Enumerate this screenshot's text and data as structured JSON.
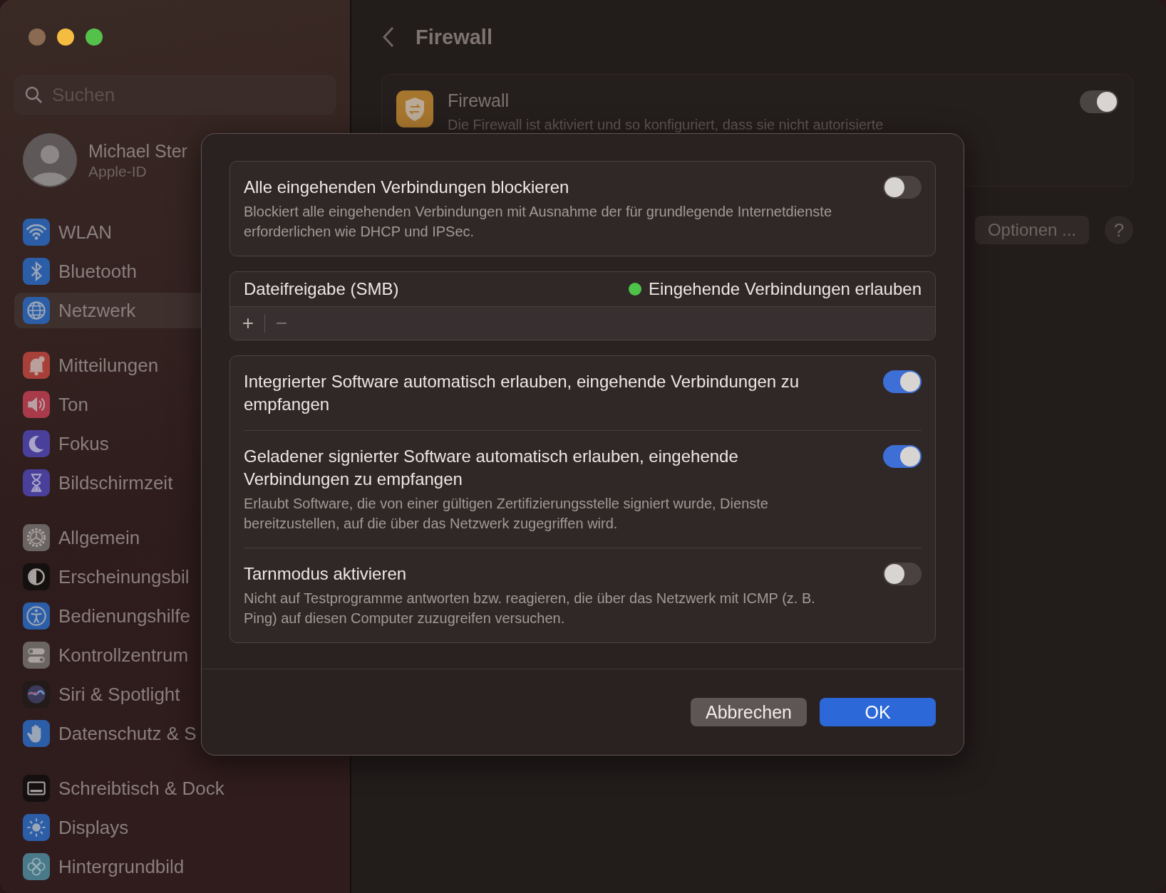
{
  "sidebar": {
    "search": {
      "placeholder": "Suchen"
    },
    "profile": {
      "name": "Michael Ster",
      "subtitle": "Apple-ID"
    },
    "groups": [
      [
        {
          "label": "WLAN",
          "kind": "wifi",
          "selected": false
        },
        {
          "label": "Bluetooth",
          "kind": "bluetooth",
          "selected": false
        },
        {
          "label": "Netzwerk",
          "kind": "globe",
          "selected": true
        }
      ],
      [
        {
          "label": "Mitteilungen",
          "kind": "bell",
          "selected": false
        },
        {
          "label": "Ton",
          "kind": "speaker",
          "selected": false
        },
        {
          "label": "Fokus",
          "kind": "moon",
          "selected": false
        },
        {
          "label": "Bildschirmzeit",
          "kind": "hourglass",
          "selected": false
        }
      ],
      [
        {
          "label": "Allgemein",
          "kind": "gear",
          "selected": false
        },
        {
          "label": "Erscheinungsbil",
          "kind": "appearance",
          "selected": false
        },
        {
          "label": "Bedienungshilfe",
          "kind": "accessibility",
          "selected": false
        },
        {
          "label": "Kontrollzentrum",
          "kind": "switches",
          "selected": false
        },
        {
          "label": "Siri & Spotlight",
          "kind": "orb",
          "selected": false
        },
        {
          "label": "Datenschutz & S",
          "kind": "hand",
          "selected": false
        }
      ],
      [
        {
          "label": "Schreibtisch & Dock",
          "kind": "dock",
          "selected": false
        },
        {
          "label": "Displays",
          "kind": "sun",
          "selected": false
        },
        {
          "label": "Hintergrundbild",
          "kind": "flower",
          "selected": false
        }
      ]
    ]
  },
  "main": {
    "title": "Firewall",
    "card": {
      "title": "Firewall",
      "description": "Die Firewall ist aktiviert und so konfiguriert, dass sie nicht autorisierte",
      "on": true
    },
    "options_button": "Optionen ...",
    "help_button": "?"
  },
  "dialog": {
    "block_all": {
      "title": "Alle eingehenden Verbindungen blockieren",
      "description": "Blockiert alle eingehenden Verbindungen mit Ausnahme der für grundlegende Internetdienste erforderlichen wie DHCP und IPSec.",
      "on": false
    },
    "services": {
      "rows": [
        {
          "name": "Dateifreigabe (SMB)",
          "status": "Eingehende Verbindungen erlauben",
          "color": "#4fc24a"
        }
      ],
      "add": "+",
      "remove": "−"
    },
    "settings": [
      {
        "title": "Integrierter Software automatisch erlauben, eingehende Verbindungen zu empfangen",
        "on": true
      },
      {
        "title": "Geladener signierter Software automatisch erlauben, eingehende Verbindungen zu empfangen",
        "description": "Erlaubt Software, die von einer gültigen Zertifizierungsstelle signiert wurde, Dienste bereitzustellen, auf die über das Netzwerk zugegriffen wird.",
        "on": true
      },
      {
        "title": "Tarnmodus aktivieren",
        "description": "Nicht auf Testprogramme antworten bzw. reagieren, die über das Netzwerk mit ICMP (z. B. Ping) auf diesen Computer zuzugreifen versuchen.",
        "on": false
      }
    ],
    "buttons": [
      {
        "label": "Abbrechen",
        "kind": "secondary"
      },
      {
        "label": "OK",
        "kind": "primary"
      }
    ]
  }
}
